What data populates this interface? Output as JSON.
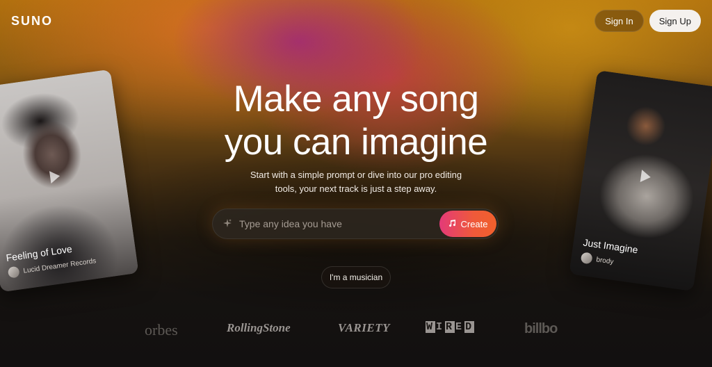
{
  "header": {
    "logo": "SUNO",
    "sign_in_label": "Sign In",
    "sign_up_label": "Sign Up"
  },
  "hero": {
    "headline_line1": "Make any song",
    "headline_line2": "you can imagine",
    "subline_line1": "Start with a simple prompt or dive into our pro editing",
    "subline_line2": "tools, your next track is just a step away."
  },
  "prompt": {
    "placeholder": "Type any idea you have",
    "value": "",
    "create_label": "Create",
    "sparkle_icon": "sparkle-icon",
    "music_icon": "music-note-icon"
  },
  "musician_button_label": "I'm a musician",
  "cards": [
    {
      "title": "Feeling of Love",
      "artist": "Lucid Dreamer Records"
    },
    {
      "title": "Just Imagine",
      "artist": "brody"
    }
  ],
  "press_logos": {
    "forbes": "orbes",
    "rolling_stone": "RollingStone",
    "variety": "VARIETY",
    "wired": [
      "W",
      "I",
      "R",
      "E",
      "D"
    ],
    "billboard": "billbo"
  },
  "colors": {
    "create_gradient_start": "#e33a78",
    "create_gradient_end": "#f0602c",
    "sign_up_bg": "#f4f1ee"
  }
}
